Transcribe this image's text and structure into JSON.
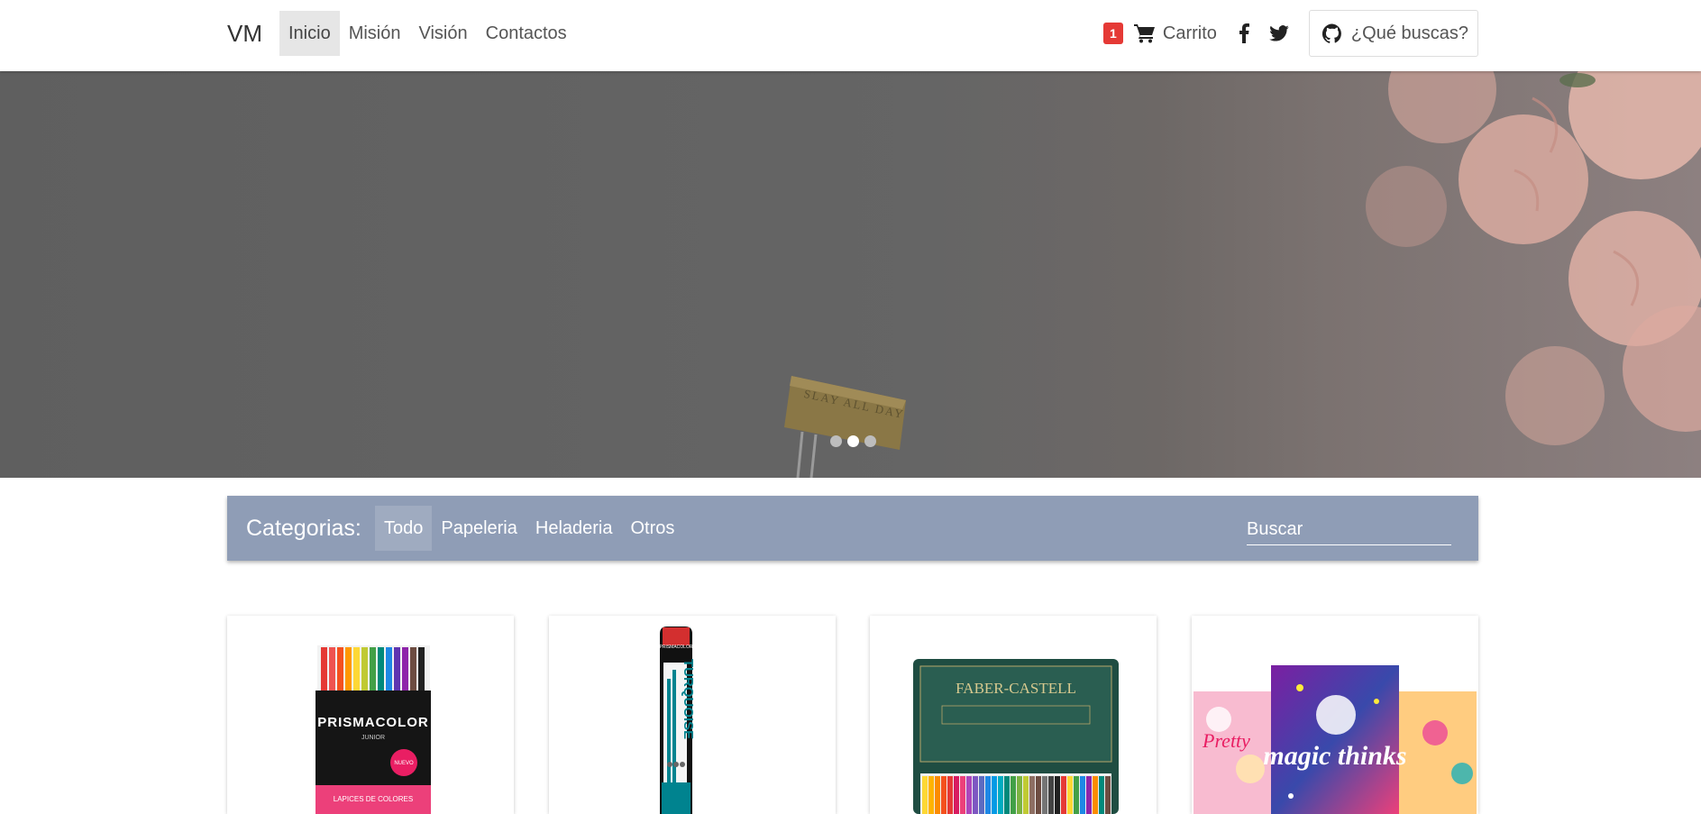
{
  "navbar": {
    "brand": "VM",
    "links": [
      {
        "label": "Inicio",
        "active": true
      },
      {
        "label": "Misión"
      },
      {
        "label": "Visión"
      },
      {
        "label": "Contactos"
      }
    ],
    "cart_count": "1",
    "cart_label": "Carrito",
    "search_button_label": "¿Qué buscas?",
    "icons": [
      "shopping-cart-icon",
      "facebook-icon",
      "twitter-icon",
      "github-icon"
    ]
  },
  "hero": {
    "slide_count": 3,
    "active_slide": 2,
    "clip_text": "SLAY ALL DAY"
  },
  "categories": {
    "title": "Categorias:",
    "items": [
      "Todo",
      "Papeleria",
      "Heladeria",
      "Otros"
    ],
    "active": "Todo",
    "search_placeholder": "Buscar"
  },
  "products": [
    {
      "brand_text": "PRISMACOLOR",
      "sub_text": "JUNIOR",
      "bottom_text": "LAPICES DE COLORES",
      "badge_text": "NUEVO"
    },
    {
      "brand_text": "PRISMACOLOR",
      "product_text": "TURQUOISE"
    },
    {
      "brand_text": "FABER-CASTELL"
    },
    {
      "product_text": "magic thinks",
      "side_text": "Pretty"
    }
  ],
  "colors": {
    "category_bar": "#8f9db6",
    "badge": "#e53935",
    "nav_active": "#e6e6e6"
  }
}
